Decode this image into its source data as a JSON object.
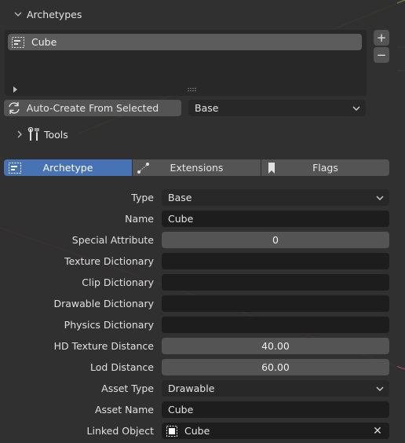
{
  "panel": {
    "section_title": "Archetypes",
    "list": {
      "items": [
        {
          "label": "Cube"
        }
      ]
    },
    "add_label": "+",
    "remove_label": "−",
    "auto_create_label": "Auto-Create From Selected",
    "auto_create_type": "Base",
    "tools_label": "Tools"
  },
  "tabs": [
    {
      "label": "Archetype",
      "icon": "archetype-icon"
    },
    {
      "label": "Extensions",
      "icon": "extensions-icon"
    },
    {
      "label": "Flags",
      "icon": "bookmark-icon"
    }
  ],
  "properties": {
    "type": {
      "label": "Type",
      "value": "Base"
    },
    "name": {
      "label": "Name",
      "value": "Cube"
    },
    "special_attribute": {
      "label": "Special Attribute",
      "value": "0"
    },
    "texture_dictionary": {
      "label": "Texture Dictionary",
      "value": ""
    },
    "clip_dictionary": {
      "label": "Clip Dictionary",
      "value": ""
    },
    "drawable_dictionary": {
      "label": "Drawable Dictionary",
      "value": ""
    },
    "physics_dictionary": {
      "label": "Physics Dictionary",
      "value": ""
    },
    "hd_texture_distance": {
      "label": "HD Texture Distance",
      "value": "40.00"
    },
    "lod_distance": {
      "label": "Lod Distance",
      "value": "60.00"
    },
    "asset_type": {
      "label": "Asset Type",
      "value": "Drawable"
    },
    "asset_name": {
      "label": "Asset Name",
      "value": "Cube"
    },
    "linked_object": {
      "label": "Linked Object",
      "value": "Cube"
    }
  },
  "colors": {
    "accent": "#4772b3",
    "panel_bg": "#303030",
    "field_bg": "#1d1d1d",
    "button_bg": "#545454"
  }
}
